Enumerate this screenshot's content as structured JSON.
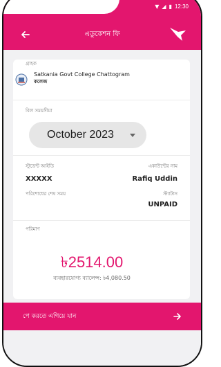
{
  "status_bar": {
    "time": "12:30",
    "icons": [
      "wifi-icon",
      "signal-icon",
      "battery-icon"
    ]
  },
  "app_bar": {
    "title": "এডুকেশন ফি",
    "back_icon": "back-arrow-icon",
    "logo_icon": "bird-logo-icon"
  },
  "institution": {
    "label": "গ্রাহক",
    "name": "Satkania Govt College Chattogram",
    "type": "কলেজ"
  },
  "billing": {
    "label": "বিল সময়সীমা",
    "selected_month": "October 2023"
  },
  "student": {
    "id_label": "স্টুডেন্ট আইডি",
    "id_value": "XXXXX",
    "name_label": "একাউন্টের নাম",
    "name_value": "Rafiq Uddin",
    "due_label": "পরিশোধের শেষ সময়",
    "status_label": "স্ট্যাটাস",
    "status_value": "UNPAID"
  },
  "amount": {
    "label": "পরিমাণ",
    "value": "৳2514.00",
    "balance_text": "ব্যবহারযোগ্য ব্যালেন্স: ৳4,080.50"
  },
  "pay_button": {
    "label": "পে করতে এগিয়ে যান"
  },
  "colors": {
    "brand": "#e3166e",
    "background": "#f1f1f3",
    "card": "#ffffff"
  }
}
